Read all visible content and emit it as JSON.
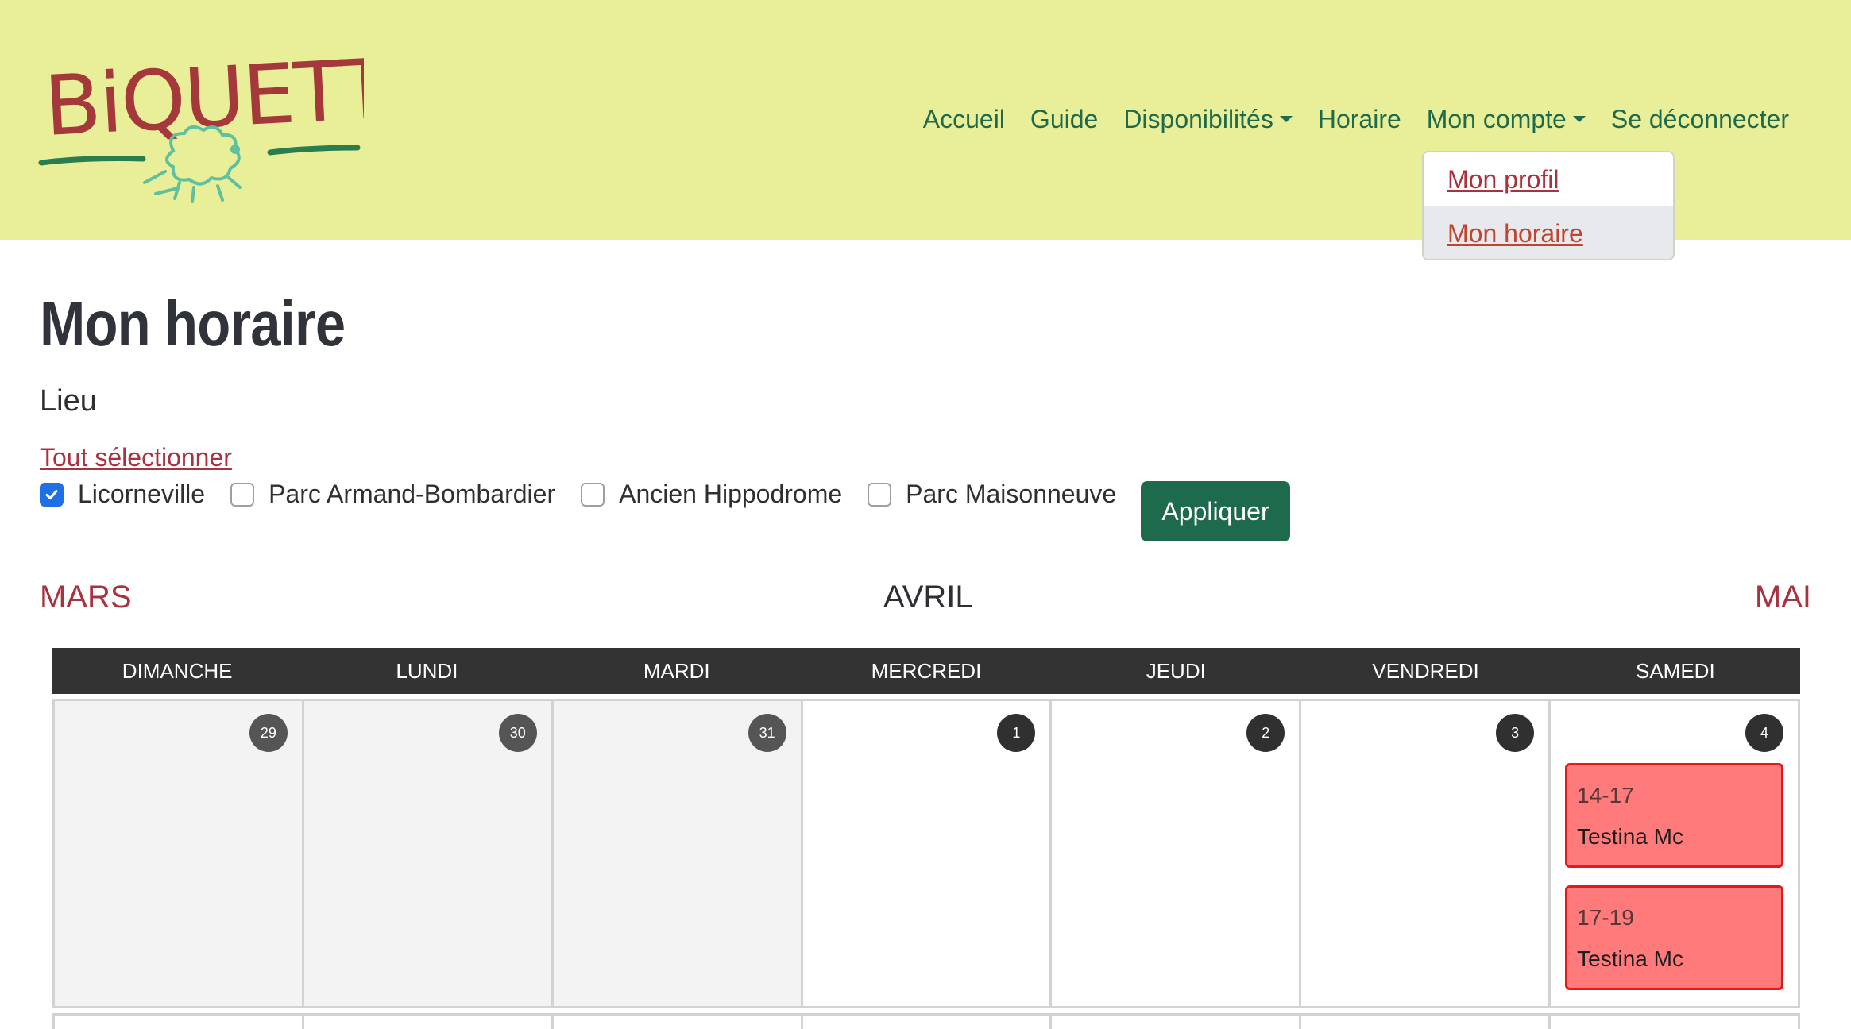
{
  "brand": {
    "logo_text": "BiQUETTE"
  },
  "nav": {
    "items": [
      {
        "label": "Accueil",
        "dropdown": false
      },
      {
        "label": "Guide",
        "dropdown": false
      },
      {
        "label": "Disponibilités",
        "dropdown": true
      },
      {
        "label": "Horaire",
        "dropdown": false
      },
      {
        "label": "Mon compte",
        "dropdown": true
      },
      {
        "label": "Se déconnecter",
        "dropdown": false
      }
    ],
    "account_menu": [
      {
        "label": "Mon profil",
        "active": false
      },
      {
        "label": "Mon horaire",
        "active": true
      }
    ]
  },
  "page": {
    "title": "Mon horaire",
    "lieu_label": "Lieu",
    "select_all": "Tout sélectionner",
    "filters": [
      {
        "label": "Licorneville",
        "checked": true
      },
      {
        "label": "Parc Armand-Bombardier",
        "checked": false
      },
      {
        "label": "Ancien Hippodrome",
        "checked": false
      },
      {
        "label": "Parc Maisonneuve",
        "checked": false
      }
    ],
    "apply_label": "Appliquer"
  },
  "calendar": {
    "prev_month": "MARS",
    "current_month": "AVRIL",
    "next_month": "MAI",
    "weekdays": [
      "DIMANCHE",
      "LUNDI",
      "MARDI",
      "MERCREDI",
      "JEUDI",
      "VENDREDI",
      "SAMEDI"
    ],
    "week1": [
      {
        "num": "29",
        "other_month": true
      },
      {
        "num": "30",
        "other_month": true
      },
      {
        "num": "31",
        "other_month": true
      },
      {
        "num": "1",
        "other_month": false
      },
      {
        "num": "2",
        "other_month": false
      },
      {
        "num": "3",
        "other_month": false
      },
      {
        "num": "4",
        "other_month": false
      }
    ],
    "events": [
      {
        "time": "14-17",
        "name": "Testina Mc"
      },
      {
        "time": "17-19",
        "name": "Testina Mc"
      }
    ]
  },
  "colors": {
    "header_bg": "#e9ef98",
    "nav_link": "#1e6a4c",
    "link_red": "#a8323e",
    "primary_button": "#1e6a4c",
    "event_bg": "#ff7b7b",
    "event_border": "#e21a1a"
  }
}
